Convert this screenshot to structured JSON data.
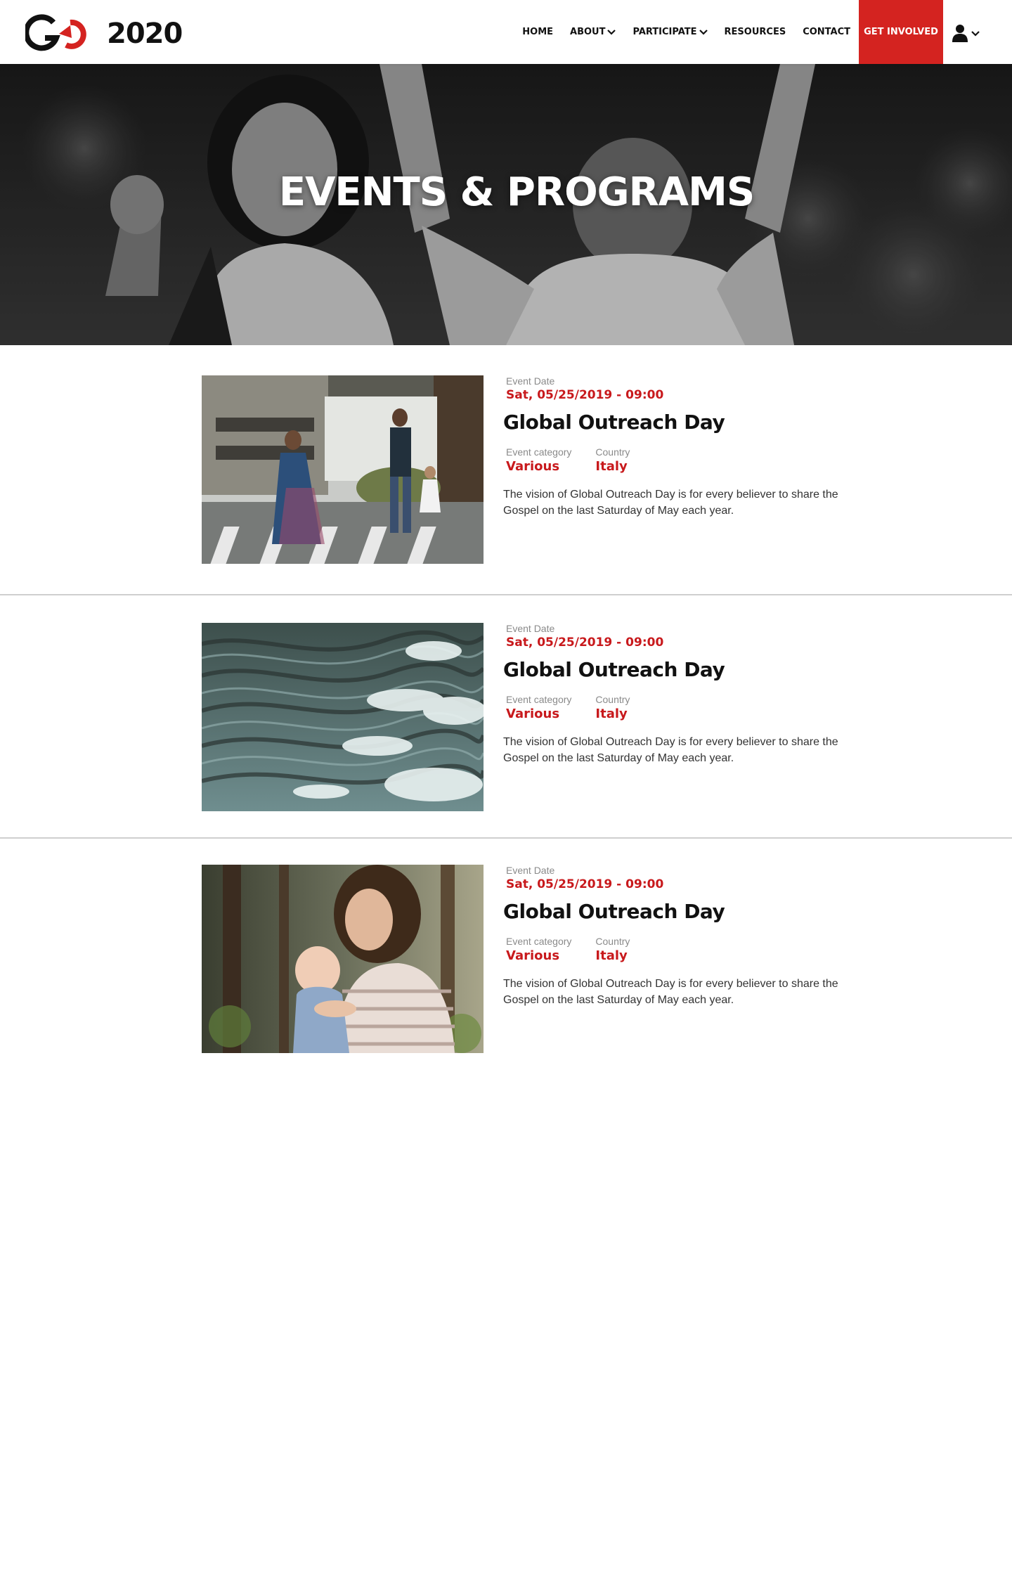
{
  "brand": {
    "logo_text": "2020",
    "accent": "#d42320"
  },
  "nav": {
    "home": "HOME",
    "about": "ABOUT",
    "participate": "PARTICIPATE",
    "resources": "RESOURCES",
    "contact": "CONTACT",
    "cta": "GET INVOLVED"
  },
  "hero": {
    "title": "EVENTS & PROGRAMS"
  },
  "labels": {
    "event_date": "Event Date",
    "event_category": "Event category",
    "country": "Country"
  },
  "events": [
    {
      "date": "Sat, 05/25/2019 - 09:00",
      "title": "Global Outreach Day",
      "category": "Various",
      "country": "Italy",
      "description": "The vision of Global Outreach Day is for every believer to share the Gospel on the last Saturday of May each year.",
      "image": "family-crossing-street-photo"
    },
    {
      "date": "Sat, 05/25/2019 - 09:00",
      "title": "Global Outreach Day",
      "category": "Various",
      "country": "Italy",
      "description": "The vision of Global Outreach Day is for every believer to share the Gospel on the last Saturday of May each year.",
      "image": "ocean-waves-photo"
    },
    {
      "date": "Sat, 05/25/2019 - 09:00",
      "title": "Global Outreach Day",
      "category": "Various",
      "country": "Italy",
      "description": "The vision of Global Outreach Day is for every believer to share the Gospel on the last Saturday of May each year.",
      "image": "mother-holding-baby-photo"
    }
  ]
}
